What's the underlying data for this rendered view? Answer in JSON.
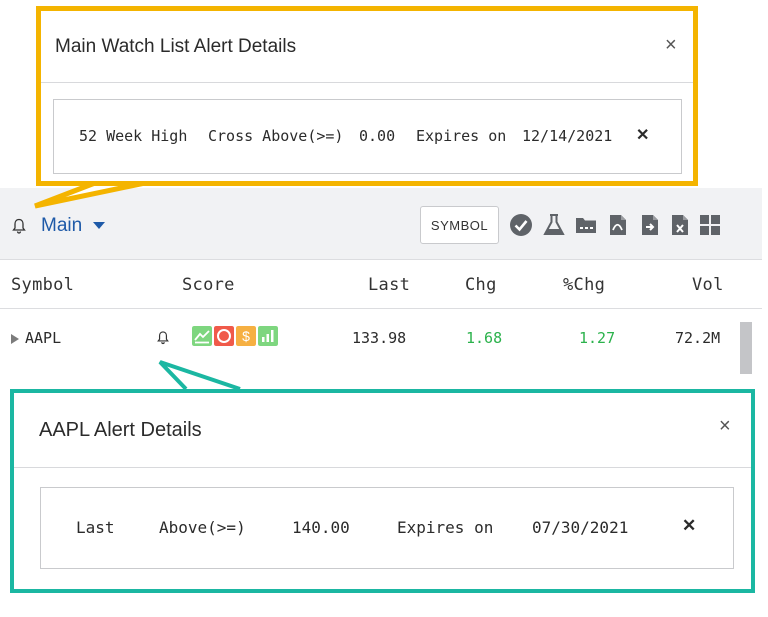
{
  "watchlist": {
    "list_name": "Main",
    "symbol_button": "SYMBOL",
    "toolbar_icons": [
      "check-circle-icon",
      "flask-icon",
      "folder-icon",
      "pdf-icon",
      "export-icon",
      "excel-icon",
      "grid-icon"
    ],
    "columns": [
      "Symbol",
      "Score",
      "Last",
      "Chg",
      "%Chg",
      "Vol"
    ],
    "rows": [
      {
        "symbol": "AAPL",
        "last": "133.98",
        "chg": "1.68",
        "pct_chg": "1.27",
        "vol": "72.2M",
        "score_badges": [
          {
            "icon": "trend-chart-icon",
            "color": "#7ed67f"
          },
          {
            "icon": "circle-icon",
            "color": "#f05a4a"
          },
          {
            "icon": "dollar-icon",
            "color": "#f6b042"
          },
          {
            "icon": "bar-chart-icon",
            "color": "#7ed67f"
          }
        ]
      }
    ]
  },
  "watchlist_alert": {
    "title": "Main Watch List Alert Details",
    "close": "×",
    "criteria": "52 Week High",
    "condition": "Cross Above(>=)",
    "value": "0.00",
    "expires_label": "Expires on",
    "expires_date": "12/14/2021",
    "delete": "✕",
    "border_color": "#f4b400"
  },
  "symbol_alert": {
    "title": "AAPL Alert Details",
    "close": "×",
    "criteria": "Last",
    "condition": "Above(>=)",
    "value": "140.00",
    "expires_label": "Expires on",
    "expires_date": "07/30/2021",
    "delete": "✕",
    "border_color": "#1bb7a2"
  },
  "colors": {
    "link_blue": "#1e5aa8",
    "positive_green": "#2bb24c",
    "icon_gray": "#5f6368"
  }
}
